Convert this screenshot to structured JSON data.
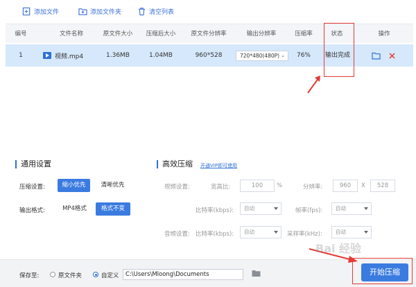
{
  "toolbar": {
    "add_file": "添加文件",
    "add_folder": "添加文件夹",
    "clear_list": "清空列表"
  },
  "table": {
    "headers": [
      "编号",
      "文件名称",
      "原文件大小",
      "压缩后大小",
      "原文件分辨率",
      "输出分辨率",
      "压缩率",
      "状态",
      "操作"
    ],
    "rows": [
      {
        "index": "1",
        "name": "视频.mp4",
        "orig_size": "1.36MB",
        "comp_size": "1.04MB",
        "orig_res": "960*528",
        "out_res": "720*480(480P)",
        "ratio": "76%",
        "status": "输出完成"
      }
    ]
  },
  "general": {
    "title": "通用设置",
    "compress_label": "压缩设置:",
    "opt_small": "缩小优先",
    "opt_clear": "清晰优先",
    "format_label": "输出格式:",
    "format_mp4": "MP4格式",
    "format_keep": "格式不变"
  },
  "advanced": {
    "title": "高效压缩",
    "vip_link": "开通VIP即可使用",
    "video_label": "视频设置:",
    "width_label": "宽高比:",
    "width_value": "100",
    "width_unit": "%",
    "res_label": "分辨率:",
    "res_w": "960",
    "res_x": "X",
    "res_h": "528",
    "bitrate_label": "比特率(kbps):",
    "bitrate_value": "自动",
    "fps_label": "帧率(fps):",
    "fps_value": "自动",
    "audio_label": "音频设置:",
    "abitrate_label": "比特率(kbps):",
    "abitrate_value": "自动",
    "sample_label": "采样率(kHz):",
    "sample_value": "自动"
  },
  "bottom": {
    "save_label": "保存至:",
    "opt_orig": "原文件夹",
    "opt_custom": "自定义",
    "path": "C:\\Users\\Mloong\\Documents",
    "start": "开始压缩"
  },
  "watermark": "Bai 经验"
}
